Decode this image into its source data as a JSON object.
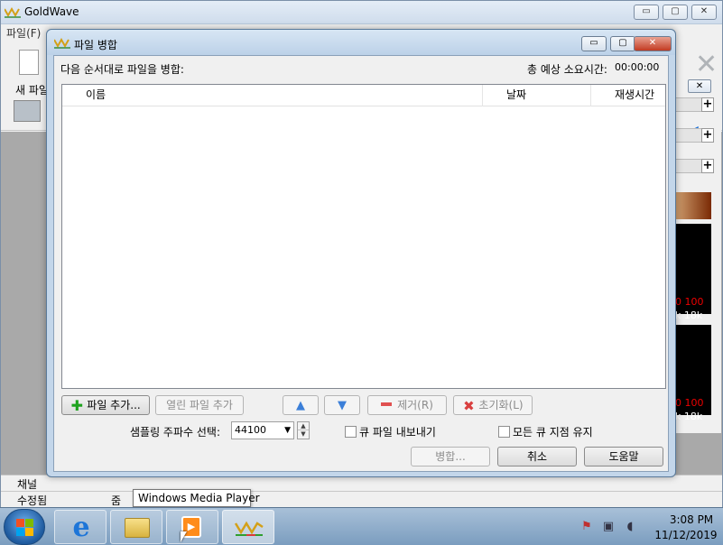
{
  "main_window": {
    "title": "GoldWave",
    "menu": {
      "file": "파일(F)"
    },
    "toolbar": {
      "new_file": "새 파일"
    },
    "controls": {
      "minimize": "▭",
      "maximize": "▢",
      "close": "✕"
    },
    "status_rows": [
      {
        "col1": "채널",
        "col2": "",
        "col3": "",
        "col4": ""
      },
      {
        "col1": "수정됨",
        "col2": "줌",
        "col3": "",
        "col4": ""
      }
    ]
  },
  "right_panel": {
    "close": "✕",
    "plus": "+",
    "scope_red": "0  100",
    "scope_white": "k  18k"
  },
  "dialog": {
    "title": "파일 병합",
    "controls": {
      "minimize": "▭",
      "maximize": "▢",
      "close": "✕"
    },
    "instruction": "다음 순서대로 파일을 병합:",
    "total_time_label": "총 예상 소요시간:",
    "total_time_value": "00:00:00",
    "columns": [
      "이름",
      "날짜",
      "재생시간"
    ],
    "buttons": {
      "add_file": "파일 추가...",
      "add_open_file": "열린 파일 추가",
      "remove": "제거(R)",
      "reset": "초기화(L)",
      "merge": "병합...",
      "cancel": "취소",
      "help": "도움말"
    },
    "sample_rate_label": "샘플링 주파수 선택:",
    "sample_rate_value": "44100",
    "checkbox_export_cue": "큐 파일 내보내기",
    "checkbox_keep_cues": "모든 큐 지점 유지"
  },
  "tooltip": "Windows Media Player",
  "taskbar": {
    "clock_time": "3:08 PM",
    "clock_date": "11/12/2019"
  },
  "colors": {
    "dialog_frame": "#c3d6ea",
    "accent_green": "#1fa31f",
    "accent_blue": "#3b7fd8",
    "accent_red": "#d94040"
  }
}
